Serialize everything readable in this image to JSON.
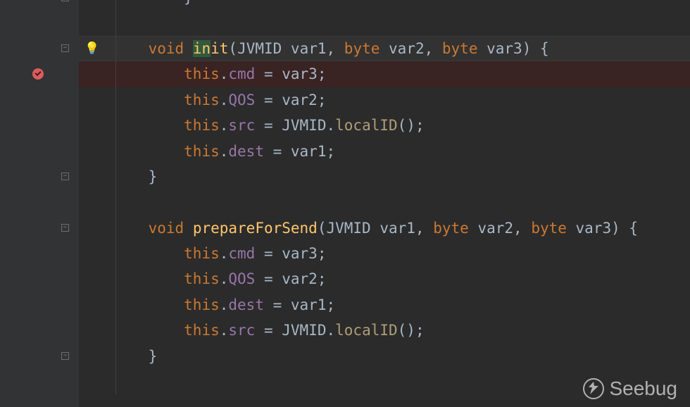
{
  "colors": {
    "bg": "#2b2b2b",
    "gutter": "#313335",
    "kw": "#cc7832",
    "method": "#ffc66d",
    "field": "#9876aa"
  },
  "watermark": {
    "text": "Seebug"
  },
  "code": {
    "lines": [
      {
        "fold": "close",
        "tokens": [
          [
            "punct",
            "        }"
          ]
        ]
      },
      {
        "tokens": []
      },
      {
        "fold": "open",
        "bulb": true,
        "current": true,
        "tokens": [
          [
            "punct",
            "    "
          ],
          [
            "kw",
            "void"
          ],
          [
            "punct",
            " "
          ],
          [
            "method-decl-caret",
            "init"
          ],
          [
            "punct",
            "("
          ],
          [
            "type",
            "JVMID"
          ],
          [
            "punct",
            " var1"
          ],
          [
            "punct",
            ", "
          ],
          [
            "kw",
            "byte"
          ],
          [
            "punct",
            " var2"
          ],
          [
            "punct",
            ", "
          ],
          [
            "kw",
            "byte"
          ],
          [
            "punct",
            " var3"
          ],
          [
            "punct",
            ") {"
          ]
        ]
      },
      {
        "breakpoint": true,
        "tokens": [
          [
            "punct",
            "        "
          ],
          [
            "kw",
            "this"
          ],
          [
            "punct",
            "."
          ],
          [
            "field",
            "cmd"
          ],
          [
            "punct",
            " = var3;"
          ]
        ]
      },
      {
        "tokens": [
          [
            "punct",
            "        "
          ],
          [
            "kw",
            "this"
          ],
          [
            "punct",
            "."
          ],
          [
            "field",
            "QOS"
          ],
          [
            "punct",
            " = var2;"
          ]
        ]
      },
      {
        "tokens": [
          [
            "punct",
            "        "
          ],
          [
            "kw",
            "this"
          ],
          [
            "punct",
            "."
          ],
          [
            "field",
            "src"
          ],
          [
            "punct",
            " = "
          ],
          [
            "type",
            "JVMID"
          ],
          [
            "punct",
            "."
          ],
          [
            "method-call",
            "localID"
          ],
          [
            "punct",
            "();"
          ]
        ]
      },
      {
        "tokens": [
          [
            "punct",
            "        "
          ],
          [
            "kw",
            "this"
          ],
          [
            "punct",
            "."
          ],
          [
            "field",
            "dest"
          ],
          [
            "punct",
            " = var1;"
          ]
        ]
      },
      {
        "fold": "close",
        "tokens": [
          [
            "punct",
            "    }"
          ]
        ]
      },
      {
        "tokens": []
      },
      {
        "fold": "open",
        "tokens": [
          [
            "punct",
            "    "
          ],
          [
            "kw",
            "void"
          ],
          [
            "punct",
            " "
          ],
          [
            "method-decl",
            "prepareForSend"
          ],
          [
            "punct",
            "("
          ],
          [
            "type",
            "JVMID"
          ],
          [
            "punct",
            " var1"
          ],
          [
            "punct",
            ", "
          ],
          [
            "kw",
            "byte"
          ],
          [
            "punct",
            " var2"
          ],
          [
            "punct",
            ", "
          ],
          [
            "kw",
            "byte"
          ],
          [
            "punct",
            " var3"
          ],
          [
            "punct",
            ") {"
          ]
        ]
      },
      {
        "tokens": [
          [
            "punct",
            "        "
          ],
          [
            "kw",
            "this"
          ],
          [
            "punct",
            "."
          ],
          [
            "field",
            "cmd"
          ],
          [
            "punct",
            " = var3;"
          ]
        ]
      },
      {
        "tokens": [
          [
            "punct",
            "        "
          ],
          [
            "kw",
            "this"
          ],
          [
            "punct",
            "."
          ],
          [
            "field",
            "QOS"
          ],
          [
            "punct",
            " = var2;"
          ]
        ]
      },
      {
        "tokens": [
          [
            "punct",
            "        "
          ],
          [
            "kw",
            "this"
          ],
          [
            "punct",
            "."
          ],
          [
            "field",
            "dest"
          ],
          [
            "punct",
            " = var1;"
          ]
        ]
      },
      {
        "tokens": [
          [
            "punct",
            "        "
          ],
          [
            "kw",
            "this"
          ],
          [
            "punct",
            "."
          ],
          [
            "field",
            "src"
          ],
          [
            "punct",
            " = "
          ],
          [
            "type",
            "JVMID"
          ],
          [
            "punct",
            "."
          ],
          [
            "method-call",
            "localID"
          ],
          [
            "punct",
            "();"
          ]
        ]
      },
      {
        "fold": "close",
        "tokens": [
          [
            "punct",
            "    }"
          ]
        ]
      },
      {
        "tokens": []
      }
    ]
  }
}
